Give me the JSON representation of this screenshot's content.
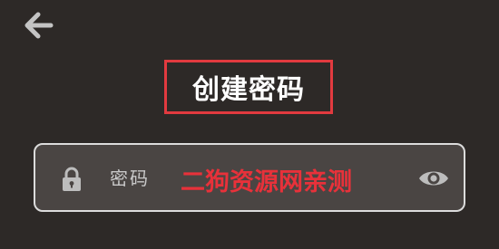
{
  "header": {
    "back_icon": "arrow-left-icon",
    "title": "创建密码"
  },
  "password_field": {
    "lock_icon": "lock-icon",
    "placeholder": "密码",
    "value": "",
    "visibility_icon": "eye-icon"
  },
  "watermark": {
    "text": "二狗资源网亲测"
  },
  "colors": {
    "background": "#2d2927",
    "field_background": "#4a4543",
    "field_border": "#dcdcdc",
    "highlight_red": "#e23a3f",
    "icon_gray": "#bdbdbd"
  }
}
